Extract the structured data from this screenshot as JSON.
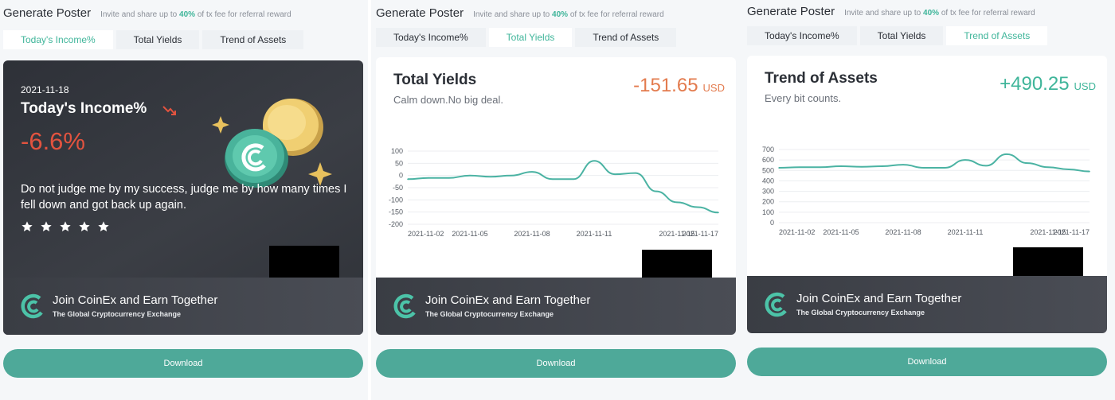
{
  "header": {
    "title": "Generate Poster",
    "invite_prefix": "Invite and share up to",
    "invite_pct": "40%",
    "invite_suffix": "of tx fee for referral reward"
  },
  "tabs": [
    "Today's Income%",
    "Total Yields",
    "Trend of Assets"
  ],
  "panels": [
    {
      "active_tab": 0,
      "card": {
        "date": "2021-11-18",
        "title": "Today's Income%",
        "value": "-6.6%",
        "value_color": "#e2533f",
        "quote": "Do not judge me by my success, judge me by how many times I fell down and got back up again.",
        "stars": 5
      }
    },
    {
      "active_tab": 1,
      "card": {
        "title": "Total Yields",
        "subtitle": "Calm down.No big deal.",
        "amount": "-151.65",
        "unit": "USD",
        "amount_color": "#e37b4e"
      }
    },
    {
      "active_tab": 2,
      "card": {
        "title": "Trend of Assets",
        "subtitle": "Every bit counts.",
        "amount": "+490.25",
        "unit": "USD",
        "amount_color": "#3fb59a"
      }
    }
  ],
  "footer": {
    "line1": "Join CoinEx and Earn Together",
    "line2": "The Global Cryptocurrency Exchange"
  },
  "download_label": "Download",
  "icons": {
    "brand_logo": "coinex-logo-icon",
    "trend": "trend-down-icon",
    "star": "star-icon",
    "sparkle": "sparkle-icon"
  },
  "colors": {
    "accent": "#3fb59a",
    "negative": "#e2533f",
    "button": "#4ea999",
    "line": "#4bb3a3"
  },
  "chart_data": [
    {
      "type": "line",
      "title": "Total Yields",
      "x_ticks": [
        "2021-11-02",
        "2021-11-05",
        "2021-11-08",
        "2021-11-11",
        "2021-11-15",
        "2021-11-17"
      ],
      "y_ticks": [
        100,
        50,
        0,
        -50,
        -100,
        -150,
        -200
      ],
      "ylim": [
        -200,
        100
      ],
      "grid": true,
      "series": [
        {
          "x": [
            "2021-11-02",
            "2021-11-03",
            "2021-11-04",
            "2021-11-05",
            "2021-11-06",
            "2021-11-07",
            "2021-11-08",
            "2021-11-09",
            "2021-11-10",
            "2021-11-11",
            "2021-11-12",
            "2021-11-13",
            "2021-11-14",
            "2021-11-15",
            "2021-11-16",
            "2021-11-17"
          ],
          "values": [
            -15,
            -10,
            -10,
            0,
            -5,
            0,
            15,
            -15,
            -15,
            60,
            5,
            10,
            -65,
            -110,
            -130,
            -152
          ]
        }
      ]
    },
    {
      "type": "line",
      "title": "Trend of Assets",
      "x_ticks": [
        "2021-11-02",
        "2021-11-05",
        "2021-11-08",
        "2021-11-11",
        "2021-11-15",
        "2021-11-17"
      ],
      "y_ticks": [
        700,
        600,
        500,
        400,
        300,
        200,
        100,
        0
      ],
      "ylim": [
        0,
        700
      ],
      "grid": true,
      "series": [
        {
          "x": [
            "2021-11-02",
            "2021-11-03",
            "2021-11-04",
            "2021-11-05",
            "2021-11-06",
            "2021-11-07",
            "2021-11-08",
            "2021-11-09",
            "2021-11-10",
            "2021-11-11",
            "2021-11-12",
            "2021-11-13",
            "2021-11-14",
            "2021-11-15",
            "2021-11-16",
            "2021-11-17"
          ],
          "values": [
            525,
            530,
            530,
            540,
            535,
            540,
            555,
            525,
            525,
            600,
            545,
            655,
            570,
            530,
            510,
            490
          ]
        }
      ]
    }
  ]
}
